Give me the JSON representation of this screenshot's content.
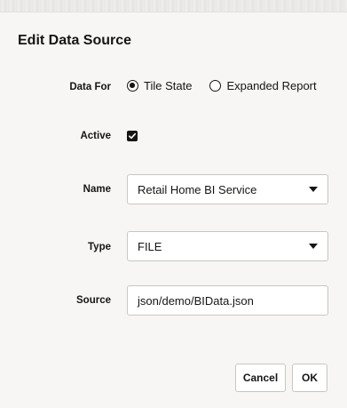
{
  "dialog": {
    "title": "Edit Data Source"
  },
  "data_for": {
    "label": "Data For",
    "options": [
      {
        "label": "Tile State",
        "selected": true
      },
      {
        "label": "Expanded Report",
        "selected": false
      }
    ]
  },
  "active": {
    "label": "Active",
    "checked": true
  },
  "name": {
    "label": "Name",
    "value": "Retail Home BI Service"
  },
  "type": {
    "label": "Type",
    "value": "FILE"
  },
  "source": {
    "label": "Source",
    "value": "json/demo/BIData.json"
  },
  "buttons": {
    "cancel": "Cancel",
    "ok": "OK"
  }
}
